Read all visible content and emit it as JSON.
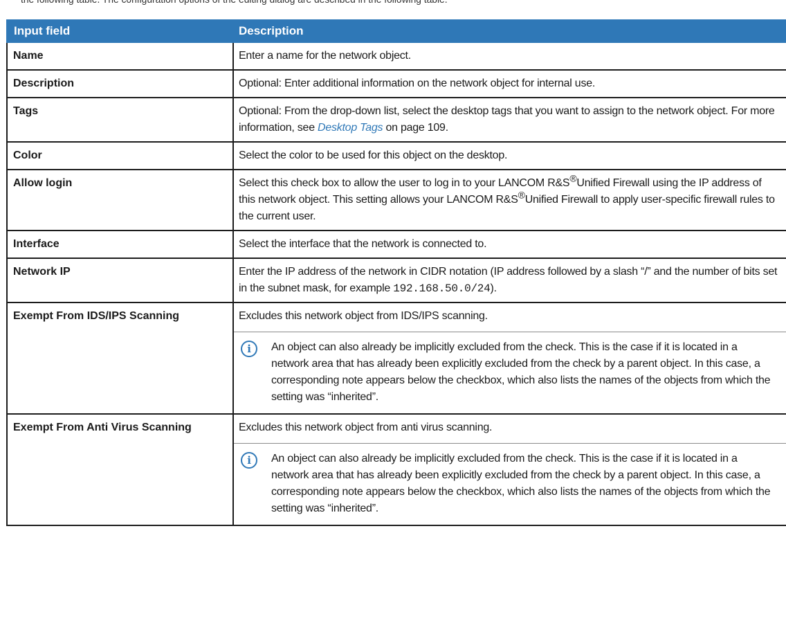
{
  "caption": "the following table. The configuration options of the editing dialog are described in the following table.",
  "table": {
    "headers": [
      "Input field",
      "Description"
    ],
    "rows": [
      {
        "label": "Name",
        "desc": "Enter a name for the network object."
      },
      {
        "label": "Description",
        "desc": "Optional: Enter additional information on the network object for internal use."
      },
      {
        "label": "Tags",
        "desc_pre": "Optional: From the drop-down list, select the desktop tags that you want to assign to the network object. For more information, see ",
        "link": "Desktop Tags",
        "desc_post": " on page 109."
      },
      {
        "label": "Color",
        "desc": "Select the color to be used for this object on the desktop."
      },
      {
        "label": "Allow login",
        "desc_a": "Select this check box to allow the user to log in to your LANCOM R&S",
        "sup1": "®",
        "desc_b": "Unified Firewall using the IP address of this network object. This setting allows your LANCOM R&S",
        "sup2": "®",
        "desc_c": "Unified Firewall to apply user-specific firewall rules to the current user."
      },
      {
        "label": "Interface",
        "desc": "Select the interface that the network is connected to."
      },
      {
        "label": "Network IP",
        "desc_pre": "Enter the IP address of the network in CIDR notation (IP address followed by a slash “/” and the number of bits set in the subnet mask, for example ",
        "code": "192.168.50.0/24",
        "desc_post": ")."
      },
      {
        "label": "Exempt From IDS/IPS Scanning",
        "desc": "Excludes this network object from IDS/IPS scanning.",
        "note": "An object can also already be implicitly excluded from the check. This is the case if it is located in a network area that has already been explicitly excluded from the check by a parent object. In this case, a corresponding note appears below the checkbox, which also lists the names of the objects from which the setting was “inherited”."
      },
      {
        "label": "Exempt From Anti Virus Scanning",
        "desc": "Excludes this network object from anti virus scanning.",
        "note": "An object can also already be implicitly excluded from the check. This is the case if it is located in a network area that has already been explicitly excluded from the check by a parent object. In this case, a corresponding note appears below the checkbox, which also lists the names of the objects from which the setting was “inherited”."
      }
    ]
  },
  "icons": {
    "note": "info-icon"
  },
  "colors": {
    "header_bg": "#2f78b7",
    "link": "#2f78b7"
  }
}
